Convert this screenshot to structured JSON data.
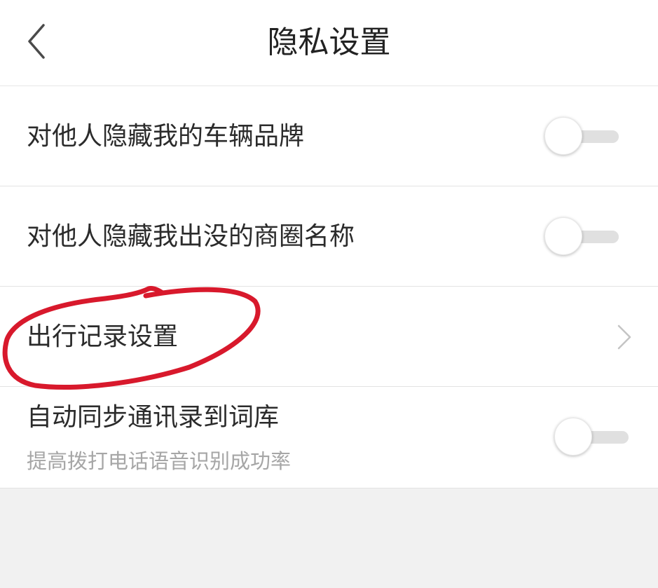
{
  "header": {
    "title": "隐私设置",
    "back_icon": "chevron-left-icon"
  },
  "settings": [
    {
      "label": "对他人隐藏我的车辆品牌",
      "type": "toggle",
      "enabled": false
    },
    {
      "label": "对他人隐藏我出没的商圈名称",
      "type": "toggle",
      "enabled": false
    },
    {
      "label": "出行记录设置",
      "type": "link",
      "icon": "chevron-right-icon",
      "highlighted": true
    },
    {
      "label": "自动同步通讯录到词库",
      "subtitle": "提高拨打电话语音识别成功率",
      "type": "toggle",
      "enabled": false
    }
  ],
  "colors": {
    "background": "#f1f1f1",
    "row": "#ffffff",
    "annotation": "#d8192c",
    "toggle_track": "#e0e0e0"
  }
}
